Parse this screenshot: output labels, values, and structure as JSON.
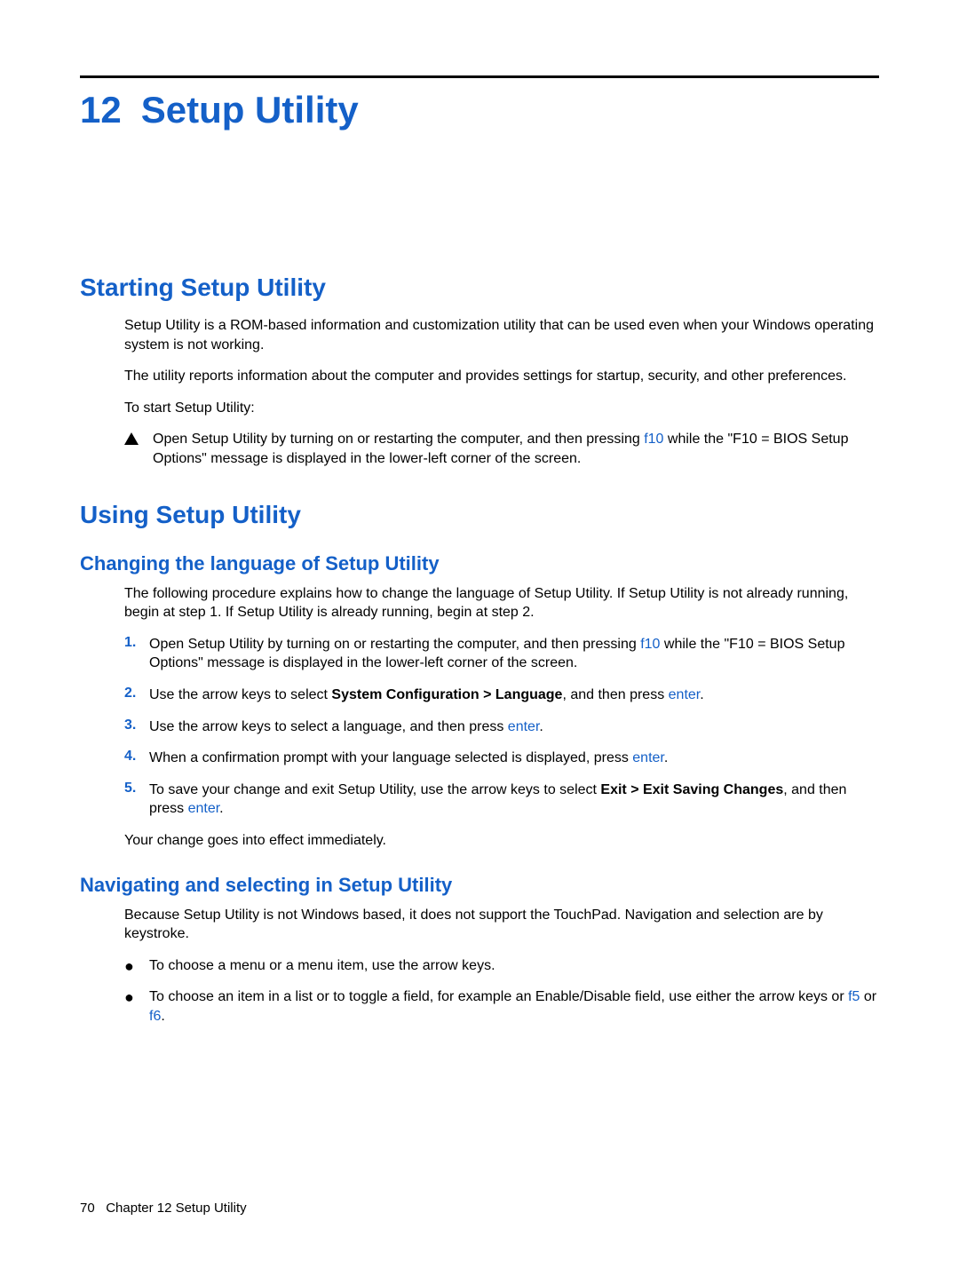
{
  "chapter": {
    "number": "12",
    "title": "Setup Utility"
  },
  "section_starting": {
    "heading": "Starting Setup Utility",
    "p1": "Setup Utility is a ROM-based information and customization utility that can be used even when your Windows operating system is not working.",
    "p2": "The utility reports information about the computer and provides settings for startup, security, and other preferences.",
    "p3": "To start Setup Utility:",
    "step_pre": "Open Setup Utility by turning on or restarting the computer, and then pressing ",
    "step_key": "f10",
    "step_post": " while the \"F10 = BIOS Setup Options\" message is displayed in the lower-left corner of the screen."
  },
  "section_using": {
    "heading": "Using Setup Utility"
  },
  "sub_language": {
    "heading": "Changing the language of Setup Utility",
    "intro": "The following procedure explains how to change the language of Setup Utility. If Setup Utility is not already running, begin at step 1. If Setup Utility is already running, begin at step 2.",
    "steps": [
      {
        "num": "1.",
        "parts": [
          {
            "t": "Open Setup Utility by turning on or restarting the computer, and then pressing "
          },
          {
            "t": "f10",
            "key": true
          },
          {
            "t": " while the \"F10 = BIOS Setup Options\" message is displayed in the lower-left corner of the screen."
          }
        ]
      },
      {
        "num": "2.",
        "parts": [
          {
            "t": "Use the arrow keys to select "
          },
          {
            "t": "System Configuration > Language",
            "bold": true
          },
          {
            "t": ", and then press "
          },
          {
            "t": "enter",
            "key": true
          },
          {
            "t": "."
          }
        ]
      },
      {
        "num": "3.",
        "parts": [
          {
            "t": "Use the arrow keys to select a language, and then press "
          },
          {
            "t": "enter",
            "key": true
          },
          {
            "t": "."
          }
        ]
      },
      {
        "num": "4.",
        "parts": [
          {
            "t": "When a confirmation prompt with your language selected is displayed, press "
          },
          {
            "t": "enter",
            "key": true
          },
          {
            "t": "."
          }
        ]
      },
      {
        "num": "5.",
        "parts": [
          {
            "t": "To save your change and exit Setup Utility, use the arrow keys to select "
          },
          {
            "t": "Exit > Exit Saving Changes",
            "bold": true
          },
          {
            "t": ", and then press "
          },
          {
            "t": "enter",
            "key": true
          },
          {
            "t": "."
          }
        ]
      }
    ],
    "outro": "Your change goes into effect immediately."
  },
  "sub_nav": {
    "heading": "Navigating and selecting in Setup Utility",
    "intro": "Because Setup Utility is not Windows based, it does not support the TouchPad. Navigation and selection are by keystroke.",
    "bullets": [
      {
        "parts": [
          {
            "t": "To choose a menu or a menu item, use the arrow keys."
          }
        ]
      },
      {
        "parts": [
          {
            "t": "To choose an item in a list or to toggle a field, for example an Enable/Disable field, use either the arrow keys or "
          },
          {
            "t": "f5",
            "key": true
          },
          {
            "t": " or "
          },
          {
            "t": "f6",
            "key": true
          },
          {
            "t": "."
          }
        ]
      }
    ]
  },
  "footer": {
    "page_num": "70",
    "chapter_label": "Chapter 12   Setup Utility"
  }
}
